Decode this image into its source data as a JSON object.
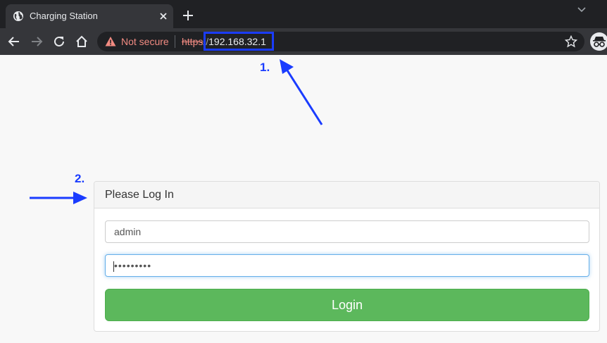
{
  "browser": {
    "tab_title": "Charging Station",
    "security_label": "Not secure",
    "url_scheme": "https",
    "url_separator": "//",
    "url_host": "192.168.32.1"
  },
  "annotations": {
    "step1": "1.",
    "step2": "2.",
    "color": "#1a3cff"
  },
  "login": {
    "heading": "Please Log In",
    "username_value": "admin",
    "password_masked": "•••••••••",
    "submit_label": "Login",
    "button_color": "#5cb85c"
  },
  "icons": [
    "globe-icon",
    "close-icon",
    "plus-icon",
    "chevron-down-icon",
    "back-arrow-icon",
    "forward-arrow-icon",
    "reload-icon",
    "home-icon",
    "warning-icon",
    "star-icon",
    "incognito-icon"
  ]
}
